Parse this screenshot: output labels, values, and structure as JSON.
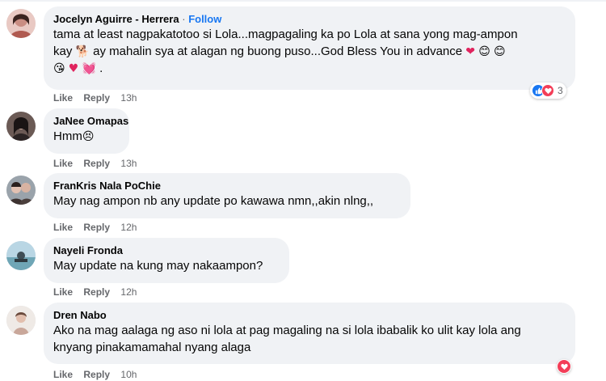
{
  "comments": [
    {
      "author": "Jocelyn Aguirre - Herrera",
      "separator": "·",
      "follow_label": "Follow",
      "line1": "tama at least nagpakatotoo si Lola...magpagaling ka po Lola at sana yong mag-ampon",
      "line2_a": "kay",
      "line2_b": "ay mahalin sya at alagan ng buong puso...God Bless You in advance",
      "line3_end": ".",
      "emoji": {
        "dog": "🐕",
        "heart_mend": "❤",
        "smile1": "😊",
        "smile2": "😊",
        "kiss": "😘",
        "heart": "♥",
        "heart_ribbon": "💓"
      },
      "like_label": "Like",
      "reply_label": "Reply",
      "time": "13h",
      "reaction_count": "3",
      "reactions": [
        "like-icon",
        "love-icon"
      ]
    },
    {
      "author": "JaNee Omapas",
      "text": "Hmm",
      "emoji": "😣",
      "like_label": "Like",
      "reply_label": "Reply",
      "time": "13h"
    },
    {
      "author": "FranKris Nala PoChie",
      "text": "May nag ampon nb any update po kawawa nmn,,akin nlng,,",
      "like_label": "Like",
      "reply_label": "Reply",
      "time": "12h"
    },
    {
      "author": "Nayeli Fronda",
      "text": "May update na kung may nakaampon?",
      "like_label": "Like",
      "reply_label": "Reply",
      "time": "12h"
    },
    {
      "author": "Dren Nabo",
      "line1": "Ako na mag aalaga ng aso ni lola at pag magaling na si lola ibabalik ko ulit kay lola ang",
      "line2": "knyang pinakamamahal nyang alaga",
      "like_label": "Like",
      "reply_label": "Reply",
      "time": "10h",
      "reactions": [
        "love-icon"
      ]
    }
  ],
  "colors": {
    "bubble": "#f0f2f5",
    "link": "#1877f2",
    "meta": "#65676b",
    "like": "#1877f2",
    "love": "#f33e58"
  }
}
